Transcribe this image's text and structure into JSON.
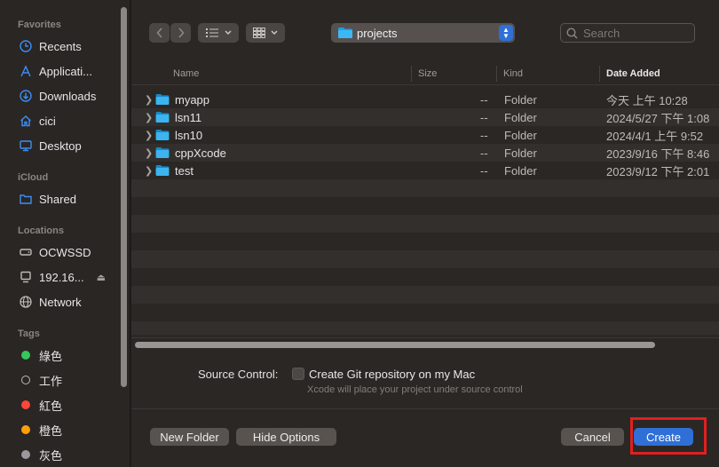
{
  "sidebar": {
    "favorites_header": "Favorites",
    "favorites": [
      {
        "label": "Recents",
        "icon": "clock-icon"
      },
      {
        "label": "Applicati...",
        "icon": "applications-icon"
      },
      {
        "label": "Downloads",
        "icon": "downloads-icon"
      },
      {
        "label": "cici",
        "icon": "home-icon"
      },
      {
        "label": "Desktop",
        "icon": "desktop-icon"
      }
    ],
    "icloud_header": "iCloud",
    "icloud": [
      {
        "label": "Shared",
        "icon": "shared-folder-icon"
      }
    ],
    "locations_header": "Locations",
    "locations": [
      {
        "label": "OCWSSD",
        "icon": "drive-icon"
      },
      {
        "label": "192.16...",
        "icon": "computer-icon"
      },
      {
        "label": "Network",
        "icon": "network-icon"
      }
    ],
    "tags_header": "Tags",
    "tags": [
      {
        "label": "綠色",
        "color": "#34c759"
      },
      {
        "label": "工作",
        "color": "none"
      },
      {
        "label": "紅色",
        "color": "#ff453a"
      },
      {
        "label": "橙色",
        "color": "#ff9f0a"
      },
      {
        "label": "灰色",
        "color": "#98989d"
      }
    ]
  },
  "toolbar": {
    "path_folder": "projects",
    "search_placeholder": "Search"
  },
  "table": {
    "columns": {
      "name": "Name",
      "size": "Size",
      "kind": "Kind",
      "date": "Date Added"
    },
    "rows": [
      {
        "name": "myapp",
        "size": "--",
        "kind": "Folder",
        "date": "今天 上午 10:28"
      },
      {
        "name": "lsn11",
        "size": "--",
        "kind": "Folder",
        "date": "2024/5/27 下午 1:08"
      },
      {
        "name": "lsn10",
        "size": "--",
        "kind": "Folder",
        "date": "2024/4/1 上午 9:52"
      },
      {
        "name": "cppXcode",
        "size": "--",
        "kind": "Folder",
        "date": "2023/9/16 下午 8:46"
      },
      {
        "name": "test",
        "size": "--",
        "kind": "Folder",
        "date": "2023/9/12 下午 2:01"
      }
    ]
  },
  "source_control": {
    "label": "Source Control:",
    "checkbox_label": "Create Git repository on my Mac",
    "checked": false,
    "hint": "Xcode will place your project under source control"
  },
  "footer": {
    "new_folder": "New Folder",
    "hide_options": "Hide Options",
    "cancel": "Cancel",
    "create": "Create"
  },
  "colors": {
    "accent": "#2f6fd6",
    "highlight_box": "#e01f1f",
    "folder": "#1aa1e8"
  }
}
